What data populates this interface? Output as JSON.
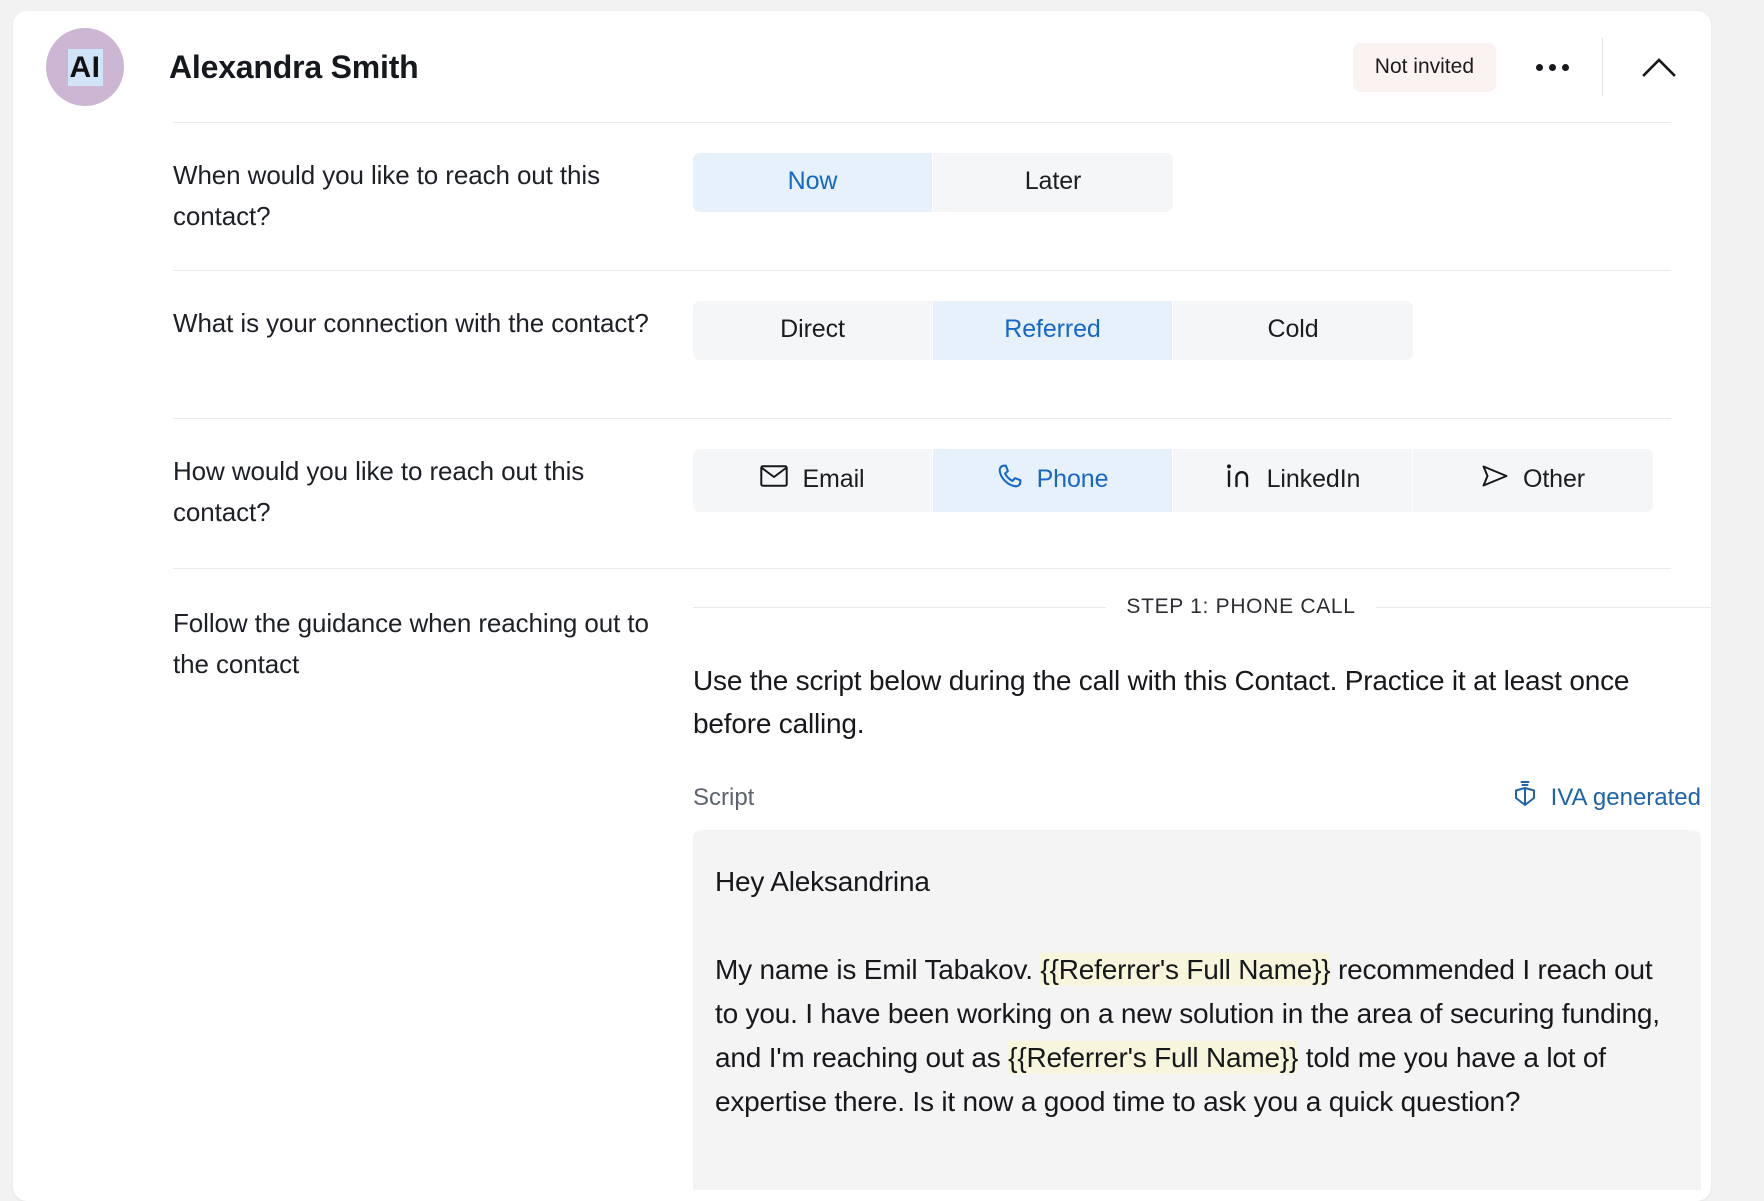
{
  "header": {
    "avatar_initials": "AI",
    "contact_name": "Alexandra Smith",
    "status_badge": "Not invited",
    "more_icon": "ellipsis-icon",
    "collapse_icon": "chevron-up-icon"
  },
  "rows": {
    "when": {
      "label": "When would you like to reach out this contact?",
      "options": [
        {
          "label": "Now",
          "selected": true
        },
        {
          "label": "Later",
          "selected": false
        }
      ]
    },
    "connection": {
      "label": "What is your connection with the contact?",
      "options": [
        {
          "label": "Direct",
          "selected": false
        },
        {
          "label": "Referred",
          "selected": true
        },
        {
          "label": "Cold",
          "selected": false
        }
      ]
    },
    "method": {
      "label": "How would you like to reach out this contact?",
      "options": [
        {
          "label": "Email",
          "icon": "envelope-icon",
          "selected": false
        },
        {
          "label": "Phone",
          "icon": "phone-icon",
          "selected": true
        },
        {
          "label": "LinkedIn",
          "icon": "linkedin-icon",
          "selected": false
        },
        {
          "label": "Other",
          "icon": "send-icon",
          "selected": false
        }
      ]
    },
    "guidance": {
      "label": "Follow the guidance when reaching out to the contact",
      "step_label": "STEP 1: PHONE CALL",
      "instruction": "Use the script below during the call with this Contact. Practice it at least once before calling.",
      "script_label": "Script",
      "iva_tag": "IVA generated",
      "iva_icon": "ai-box-icon",
      "copy_icon": "copy-icon",
      "script": {
        "greeting": "Hey Aleksandrina",
        "body_segments": [
          {
            "text": "My name is Emil Tabakov. ",
            "token": false
          },
          {
            "text": "{{Referrer's Full Name}}",
            "token": true
          },
          {
            "text": " recommended I reach out to you. I have been working on a new solution in the area of securing funding, and I'm reaching out as ",
            "token": false
          },
          {
            "text": "{{Referrer's Full Name}}",
            "token": true
          },
          {
            "text": " told me you have a lot of expertise there. Is it now a good time to ask you a quick question?",
            "token": false
          }
        ]
      }
    }
  },
  "colors": {
    "accent_blue": "#1668c5",
    "selected_bg": "#e7f1fb",
    "segment_bg": "#f5f6f7",
    "badge_bg": "#faf3f2",
    "avatar_bg": "#ccb6d4",
    "token_highlight": "#f7f5dc",
    "script_bg": "#f4f4f5"
  }
}
